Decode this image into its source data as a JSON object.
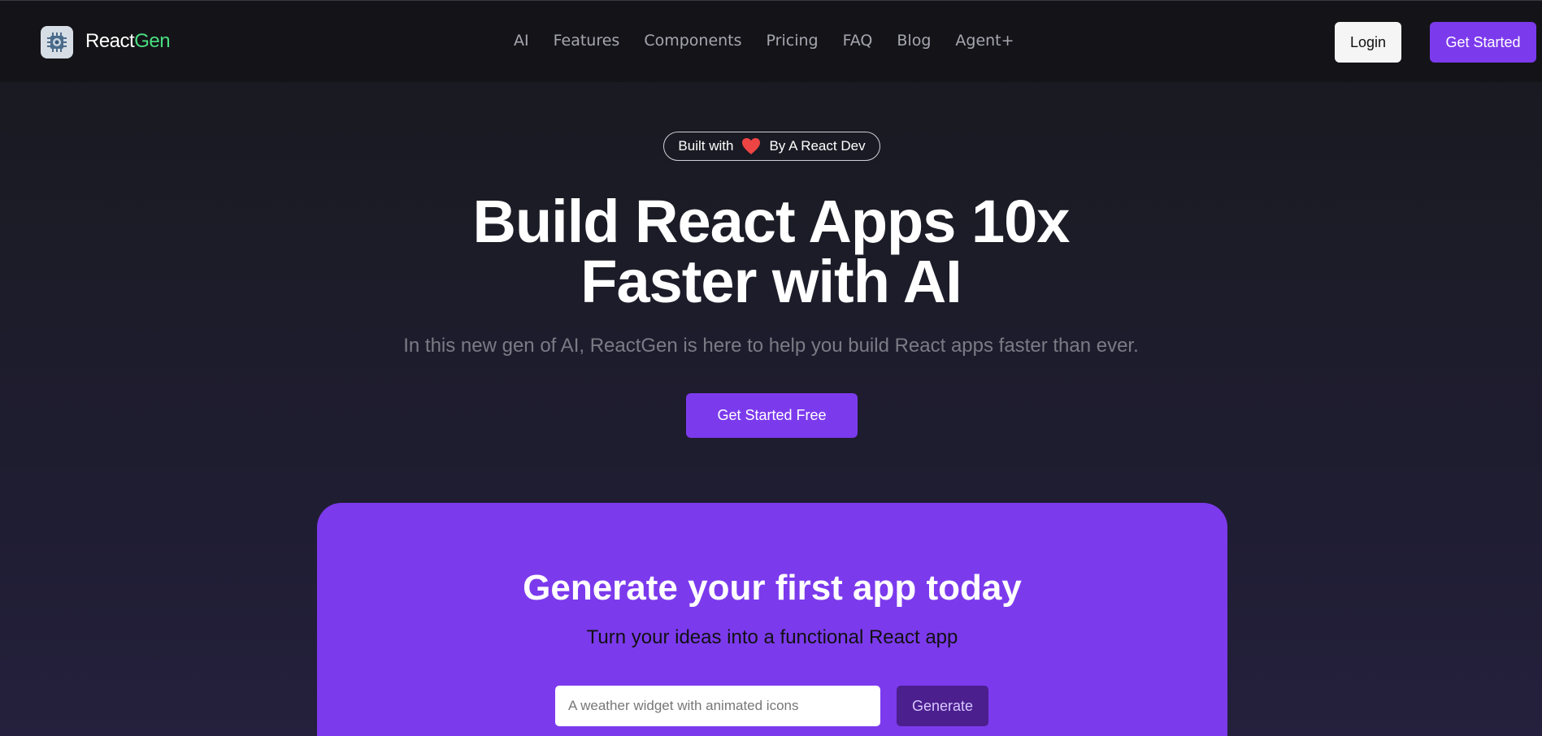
{
  "nav": {
    "brand_prefix": "React",
    "brand_accent": "Gen",
    "links": [
      {
        "label": "AI"
      },
      {
        "label": "Features"
      },
      {
        "label": "Components"
      },
      {
        "label": "Pricing"
      },
      {
        "label": "FAQ"
      },
      {
        "label": "Blog"
      },
      {
        "label": "Agent+"
      }
    ],
    "login_label": "Login",
    "get_started_label": "Get Started"
  },
  "hero": {
    "badge_before": "Built with",
    "badge_icon": "heart-icon",
    "badge_after": "By A React Dev",
    "title_line1": "Build React Apps 10x",
    "title_line2": "Faster with AI",
    "subtitle": "In this new gen of AI, ReactGen is here to help you build React apps faster than ever.",
    "cta_label": "Get Started Free"
  },
  "generator": {
    "title": "Generate your first app today",
    "subtitle": "Turn your ideas into a functional React app",
    "input_placeholder": "A weather widget with animated icons",
    "input_value": "",
    "button_label": "Generate"
  },
  "colors": {
    "accent": "#7c3aed",
    "brand_green": "#4ade80",
    "background": "#1b1b25",
    "generate_button": "#4b1f8e"
  }
}
